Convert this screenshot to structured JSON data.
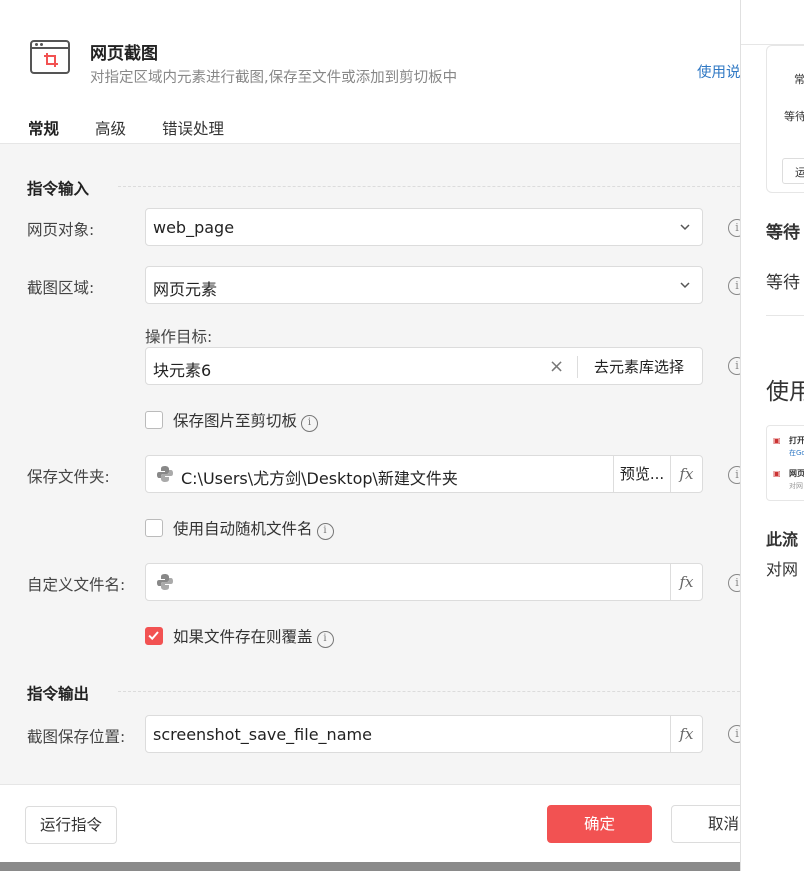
{
  "header": {
    "title": "网页截图",
    "subtitle": "对指定区域内元素进行截图,保存至文件或添加到剪切板中",
    "help_link": "使用说"
  },
  "tabs": [
    {
      "label": "常规",
      "active": true
    },
    {
      "label": "高级",
      "active": false
    },
    {
      "label": "错误处理",
      "active": false
    }
  ],
  "sections": {
    "input": "指令输入",
    "output": "指令输出"
  },
  "fields": {
    "web_object": {
      "label": "网页对象:",
      "value": "web_page"
    },
    "screenshot_area": {
      "label": "截图区域:",
      "value": "网页元素"
    },
    "target": {
      "label": "操作目标:",
      "value": "块元素6",
      "pick_button": "去元素库选择"
    },
    "save_to_clipboard": {
      "label": "保存图片至剪切板",
      "checked": false
    },
    "save_folder": {
      "label": "保存文件夹:",
      "value": "C:\\Users\\尤方剑\\Desktop\\新建文件夹",
      "preview_button": "预览..."
    },
    "auto_random_name": {
      "label": "使用自动随机文件名",
      "checked": false
    },
    "custom_filename": {
      "label": "自定义文件名:",
      "value": ""
    },
    "overwrite": {
      "label": "如果文件存在则覆盖",
      "checked": true
    },
    "save_location": {
      "label": "截图保存位置:",
      "value": "screenshot_save_file_name"
    }
  },
  "icons": {
    "fx": "fx",
    "info": "i"
  },
  "footer": {
    "run_button": "运行指令",
    "ok_button": "确定",
    "cancel_button": "取消"
  },
  "right_panel": {
    "card_text_1": "常",
    "card_text_2": "等待",
    "card_button": "运",
    "heading": "等待",
    "text_1": "等待",
    "big_heading": "使用",
    "mini_item_1_title": "打开",
    "mini_item_1_sub": "在Go",
    "mini_item_2_title": "网页",
    "mini_item_2_sub": "对网",
    "bold_text": "此流",
    "text_2": "对网"
  },
  "colors": {
    "accent": "#f25252",
    "link": "#2f78c4"
  }
}
